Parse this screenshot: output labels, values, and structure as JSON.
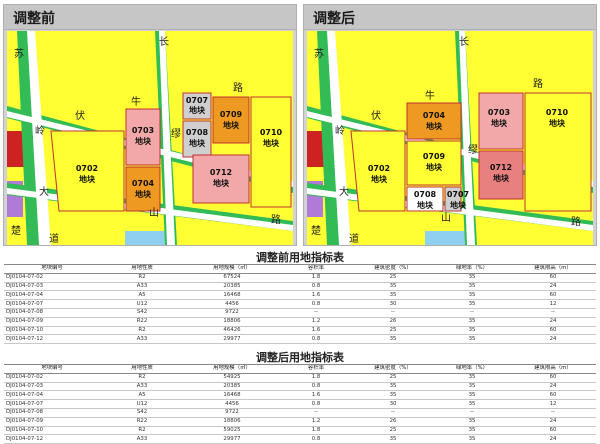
{
  "panels": {
    "before": {
      "title": "调整前",
      "roads": {
        "su": "苏",
        "ling": "岭",
        "da": "大",
        "chu": "楚",
        "dao": "道",
        "fu": "伏",
        "niu": "牛",
        "lu1": "路",
        "shan": "山",
        "lu2": "路",
        "chang": "长",
        "mian": "缪"
      },
      "parcels": {
        "p0702": [
          "0702",
          "地块"
        ],
        "p0703": [
          "0703",
          "地块"
        ],
        "p0704": [
          "0704",
          "地块"
        ],
        "p0707": [
          "0707",
          "地块"
        ],
        "p0708": [
          "0708",
          "地块"
        ],
        "p0709": [
          "0709",
          "地块"
        ],
        "p0710": [
          "0710",
          "地块"
        ],
        "p0712": [
          "0712",
          "地块"
        ]
      }
    },
    "after": {
      "title": "调整后",
      "roads": {
        "su": "苏",
        "ling": "岭",
        "da": "大",
        "chu": "楚",
        "dao": "道",
        "fu": "伏",
        "niu": "牛",
        "lu1": "路",
        "shan": "山",
        "lu2": "路",
        "chang": "长",
        "mian": "缪"
      },
      "parcels": {
        "p0702": [
          "0702",
          "地块"
        ],
        "p0703": [
          "0703",
          "地块"
        ],
        "p0704": [
          "0704",
          "地块"
        ],
        "p0707": [
          "0707",
          "地块"
        ],
        "p0708": [
          "0708",
          "地块"
        ],
        "p0709": [
          "0709",
          "地块"
        ],
        "p0710": [
          "0710",
          "地块"
        ],
        "p0712": [
          "0712",
          "地块"
        ]
      }
    }
  },
  "colors": {
    "residential": "#ffff33",
    "commercial": "#ee9922",
    "business": "#f2a8a8",
    "business_red": "#e05555",
    "utility": "#cfcfcf",
    "green": "#33bb55",
    "road": "#ffffff",
    "water": "#8fd0f0",
    "purple": "#b07ad8",
    "red": "#cc2222"
  },
  "headers": [
    "地块编号",
    "用地性质",
    "用地规模（㎡）",
    "容积率",
    "建筑密度（%）",
    "绿地率（%）",
    "建筑限高（m）"
  ],
  "table_before": {
    "title": "调整前用地指标表",
    "rows": [
      [
        "DJ0104-07-02",
        "R2",
        "67524",
        "1.8",
        "25",
        "35",
        "60"
      ],
      [
        "DJ0104-07-03",
        "A33",
        "20385",
        "0.8",
        "35",
        "35",
        "24"
      ],
      [
        "DJ0104-07-04",
        "A5",
        "16468",
        "1.6",
        "35",
        "35",
        "60"
      ],
      [
        "DJ0104-07-07",
        "U12",
        "4456",
        "0.8",
        "30",
        "35",
        "12"
      ],
      [
        "DJ0104-07-08",
        "S42",
        "9722",
        "--",
        "--",
        "--",
        "--"
      ],
      [
        "DJ0104-07-09",
        "R22",
        "18806",
        "1.2",
        "26",
        "35",
        "24"
      ],
      [
        "DJ0104-07-10",
        "R2",
        "46426",
        "1.6",
        "25",
        "35",
        "60"
      ],
      [
        "DJ0104-07-12",
        "A33",
        "29977",
        "0.8",
        "35",
        "35",
        "24"
      ]
    ]
  },
  "table_after": {
    "title": "调整后用地指标表",
    "rows": [
      [
        "DJ0104-07-02",
        "R2",
        "54925",
        "1.8",
        "25",
        "35",
        "60"
      ],
      [
        "DJ0104-07-03",
        "A33",
        "20385",
        "0.8",
        "35",
        "35",
        "24"
      ],
      [
        "DJ0104-07-04",
        "A5",
        "16468",
        "1.6",
        "35",
        "35",
        "60"
      ],
      [
        "DJ0104-07-07",
        "U12",
        "4456",
        "0.8",
        "30",
        "35",
        "12"
      ],
      [
        "DJ0104-07-08",
        "S42",
        "9722",
        "--",
        "--",
        "--",
        "--"
      ],
      [
        "DJ0104-07-09",
        "R22",
        "18806",
        "1.2",
        "26",
        "35",
        "24"
      ],
      [
        "DJ0104-07-10",
        "R2",
        "59025",
        "1.8",
        "25",
        "35",
        "60"
      ],
      [
        "DJ0104-07-12",
        "A33",
        "29977",
        "0.8",
        "35",
        "35",
        "24"
      ]
    ]
  }
}
